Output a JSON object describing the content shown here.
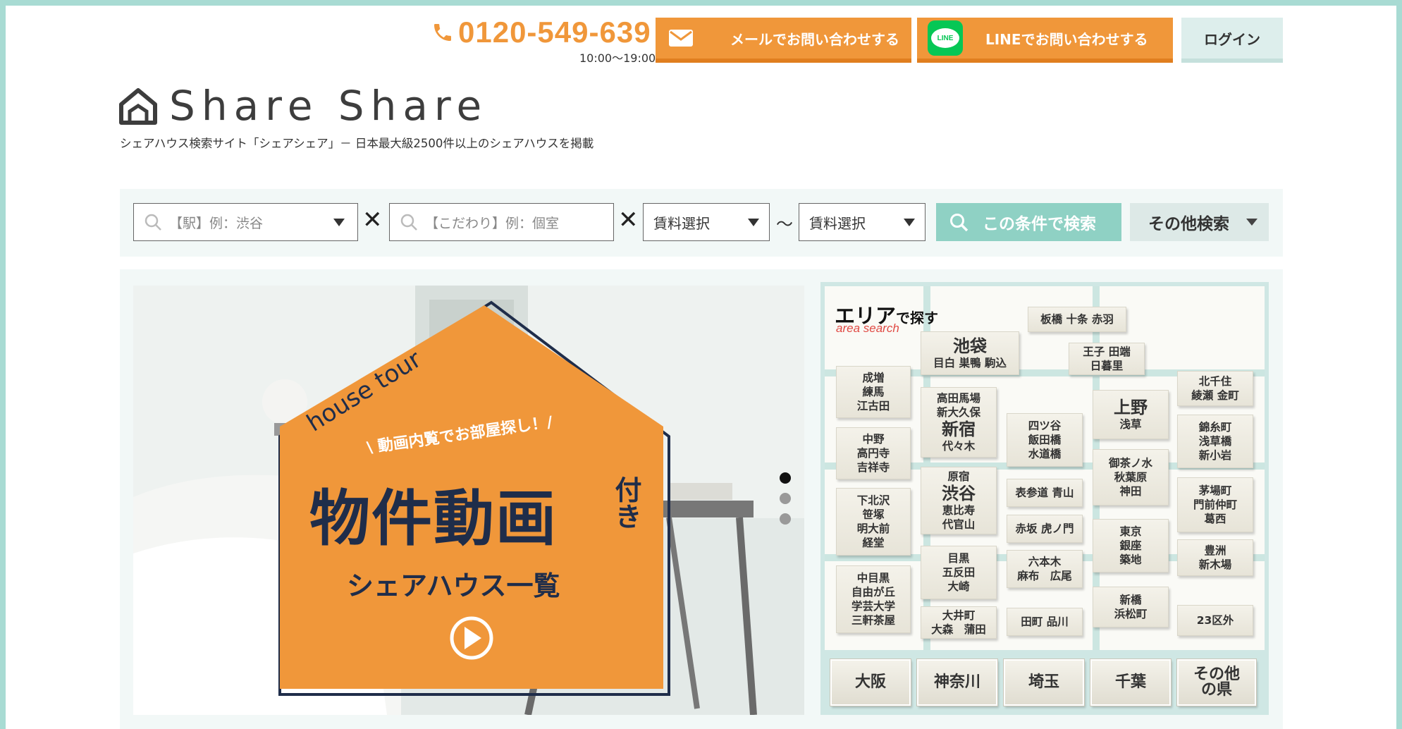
{
  "header": {
    "phone": "0120-549-639",
    "hours": "10:00〜19:00",
    "mail_button": "メールでお問い合わせする",
    "line_button": "LINEでお問い合わせする",
    "line_logo_text": "LINE",
    "login_button": "ログイン",
    "logo_text": "Share Share",
    "tagline": "シェアハウス検索サイト「シェアシェア」－ 日本最大級2500件以上のシェアハウスを掲載"
  },
  "search": {
    "station_placeholder": "【駅】例：渋谷",
    "feature_placeholder": "【こだわり】例：個室",
    "rent_min": "賃料選択",
    "rent_max": "賃料選択",
    "cross": "✕",
    "tilde": "〜",
    "search_button": "この条件で検索",
    "other_button": "その他検索"
  },
  "banner": {
    "house_tour": "house tour",
    "catch": "\\ 動画内覧でお部屋探し！/",
    "main": "物件動画",
    "suffix": "付き",
    "sub": "シェアハウス一覧",
    "slides": 3,
    "active_slide": 1
  },
  "area": {
    "title": "エリア",
    "title_suffix": "で探す",
    "subtitle": "area search",
    "tiles": {
      "itabashi": "板橋 十条 赤羽",
      "ikebukuro_big": "池袋",
      "ikebukuro_sub": "目白 巣鴨 駒込",
      "oji_1": "王子 田端",
      "oji_2": "日暮里",
      "kitasenju_1": "北千住",
      "kitasenju_2": "綾瀬 金町",
      "narimasu_1": "成増",
      "narimasu_2": "練馬",
      "narimasu_3": "江古田",
      "takadanobaba_1": "高田馬場",
      "takadanobaba_2": "新大久保",
      "shinjuku_big": "新宿",
      "shinjuku_sub": "代々木",
      "yotsuya_1": "四ツ谷",
      "yotsuya_2": "飯田橋",
      "yotsuya_3": "水道橋",
      "ueno_big": "上野",
      "ueno_sub": "浅草",
      "kinshicho_1": "錦糸町",
      "kinshicho_2": "浅草橋",
      "kinshicho_3": "新小岩",
      "nakano_1": "中野",
      "nakano_2": "高円寺",
      "nakano_3": "吉祥寺",
      "ochanomizu_1": "御茶ノ水",
      "ochanomizu_2": "秋葉原",
      "ochanomizu_3": "神田",
      "harajuku": "原宿",
      "shibuya_big": "渋谷",
      "shibuya_1": "恵比寿",
      "shibuya_2": "代官山",
      "omotesando": "表参道 青山",
      "kayabacho_1": "茅場町",
      "kayabacho_2": "門前仲町",
      "kayabacho_3": "葛西",
      "shimokita_1": "下北沢",
      "shimokita_2": "笹塚",
      "shimokita_3": "明大前",
      "shimokita_4": "経堂",
      "akasaka": "赤坂 虎ノ門",
      "tokyo_1": "東京",
      "tokyo_2": "銀座",
      "tokyo_3": "築地",
      "toyosu_1": "豊洲",
      "toyosu_2": "新木場",
      "roppongi_1": "六本木",
      "roppongi_2": "麻布　広尾",
      "meguro_1": "目黒",
      "meguro_2": "五反田",
      "meguro_3": "大崎",
      "nakameguro_1": "中目黒",
      "nakameguro_2": "自由が丘",
      "nakameguro_3": "学芸大学",
      "nakameguro_4": "三軒茶屋",
      "shimbashi_1": "新橋",
      "shimbashi_2": "浜松町",
      "oimachi_1": "大井町",
      "oimachi_2": "大森　蒲田",
      "tamachi": "田町 品川",
      "outside23": "23区外"
    },
    "prefectures": [
      "大阪",
      "神奈川",
      "埼玉",
      "千葉",
      "その他の県"
    ]
  }
}
